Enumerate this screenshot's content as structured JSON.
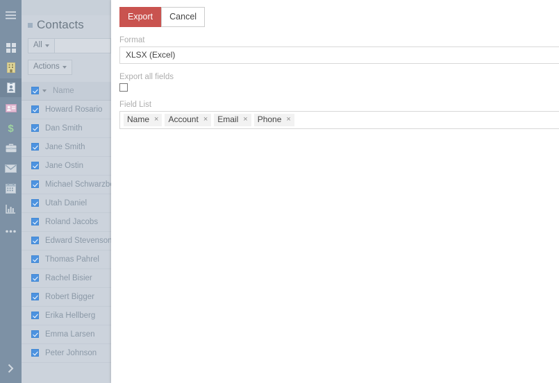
{
  "sidebar": {
    "items": [
      {
        "icon": "hamburger-menu-icon",
        "color": "#d8dee5"
      },
      {
        "icon": "grid-dashboard-icon",
        "color": "#d8dee5"
      },
      {
        "icon": "building-icon",
        "color": "#e0d69a"
      },
      {
        "icon": "contact-badge-icon",
        "color": "#cfd7df",
        "active": true
      },
      {
        "icon": "id-card-icon",
        "color": "#e3bdd4"
      },
      {
        "icon": "dollar-sign-icon",
        "color": "#9fd3a0"
      },
      {
        "icon": "briefcase-icon",
        "color": "#d2d9e0"
      },
      {
        "icon": "envelope-icon",
        "color": "#d2d9e0"
      },
      {
        "icon": "calendar-icon",
        "color": "#d2d9e0"
      },
      {
        "icon": "bar-chart-icon",
        "color": "#d2d9e0"
      },
      {
        "icon": "ellipsis-more-icon",
        "color": "#d2d9e0"
      }
    ],
    "expand_toggle_icon": "chevron-right-icon"
  },
  "list_panel": {
    "title": "Contacts",
    "filter_dropdown_label": "All",
    "search_placeholder": "",
    "search_value": "",
    "actions_dropdown_label": "Actions",
    "column_header": "Name",
    "rows": [
      {
        "name": "Howard Rosario",
        "checked": true
      },
      {
        "name": "Dan Smith",
        "checked": true
      },
      {
        "name": "Jane Smith",
        "checked": true
      },
      {
        "name": "Jane Ostin",
        "checked": true
      },
      {
        "name": "Michael Schwarzbe",
        "checked": true
      },
      {
        "name": "Utah Daniel",
        "checked": true
      },
      {
        "name": "Roland Jacobs",
        "checked": true
      },
      {
        "name": "Edward Stevenson",
        "checked": true
      },
      {
        "name": "Thomas Pahrel",
        "checked": true
      },
      {
        "name": "Rachel Bisier",
        "checked": true
      },
      {
        "name": "Robert Bigger",
        "checked": true
      },
      {
        "name": "Erika Hellberg",
        "checked": true
      },
      {
        "name": "Emma Larsen",
        "checked": true
      },
      {
        "name": "Peter Johnson",
        "checked": true
      }
    ]
  },
  "export_dialog": {
    "submit_label": "Export",
    "cancel_label": "Cancel",
    "format_label": "Format",
    "format_value": "XLSX (Excel)",
    "export_all_label": "Export all fields",
    "export_all_checked": false,
    "field_list_label": "Field List",
    "field_tags": [
      "Name",
      "Account",
      "Email",
      "Phone"
    ],
    "tag_remove_glyph": "×"
  },
  "colors": {
    "sidebar_bg": "#7d91a5",
    "list_bg": "#ccd3dc",
    "accent_danger": "#c9534f",
    "checkbox_blue": "#4d93e0"
  }
}
